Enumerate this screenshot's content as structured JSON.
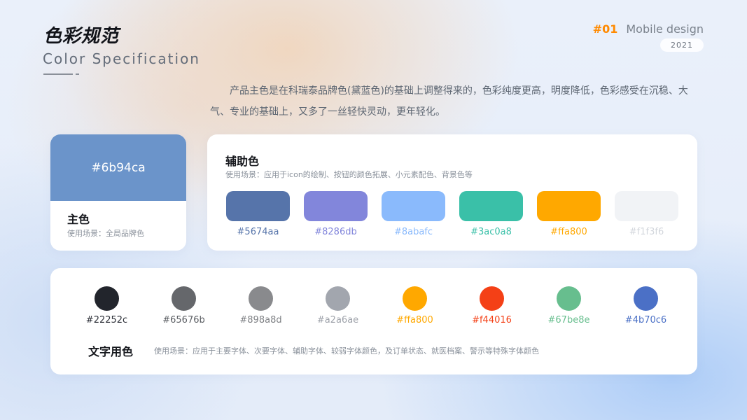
{
  "header": {
    "title_cn": "色彩规范",
    "title_en": "Color Specification",
    "number": "#01",
    "subtitle": "Mobile design",
    "year": "2021"
  },
  "description": "产品主色是在科瑞泰品牌色(黛蓝色)的基础上调整得来的，色彩纯度更高，明度降低，色彩感受在沉稳、大气、专业的基础上，又多了一丝轻快灵动，更年轻化。",
  "primary": {
    "hex": "#6b94ca",
    "color": "#6b94ca",
    "label": "主色",
    "usage": "使用场景：全局品牌色"
  },
  "auxiliary": {
    "title": "辅助色",
    "usage": "使用场景：应用于icon的绘制、按钮的颜色拓展、小元素配色、背景色等",
    "colors": [
      {
        "hex": "#5674aa",
        "color": "#5674aa"
      },
      {
        "hex": "#8286db",
        "color": "#8286db"
      },
      {
        "hex": "#8abafc",
        "color": "#8abafc"
      },
      {
        "hex": "#3ac0a8",
        "color": "#3ac0a8"
      },
      {
        "hex": "#ffa800",
        "color": "#ffa800"
      },
      {
        "hex": "#f1f3f6",
        "color": "#f1f3f6"
      }
    ]
  },
  "text_colors": {
    "title": "文字用色",
    "usage": "使用场景：应用于主要字体、次要字体、辅助字体、较弱字体颜色，及订单状态、就医档案、警示等特殊字体颜色",
    "colors": [
      {
        "hex": "#22252c",
        "color": "#22252c",
        "label_color": "#2d3038"
      },
      {
        "hex": "#65676b",
        "color": "#65676b",
        "label_color": "#5a5d62"
      },
      {
        "hex": "#898a8d",
        "color": "#898a8d",
        "label_color": "#7e8084"
      },
      {
        "hex": "#a2a6ae",
        "color": "#a2a6ae",
        "label_color": "#9ea2aa"
      },
      {
        "hex": "#ffa800",
        "color": "#ffa800",
        "label_color": "#ffa800"
      },
      {
        "hex": "#f44016",
        "color": "#f44016",
        "label_color": "#f44016"
      },
      {
        "hex": "#67be8e",
        "color": "#67be8e",
        "label_color": "#67be8e"
      },
      {
        "hex": "#4b70c6",
        "color": "#4b70c6",
        "label_color": "#4b70c6"
      }
    ]
  }
}
